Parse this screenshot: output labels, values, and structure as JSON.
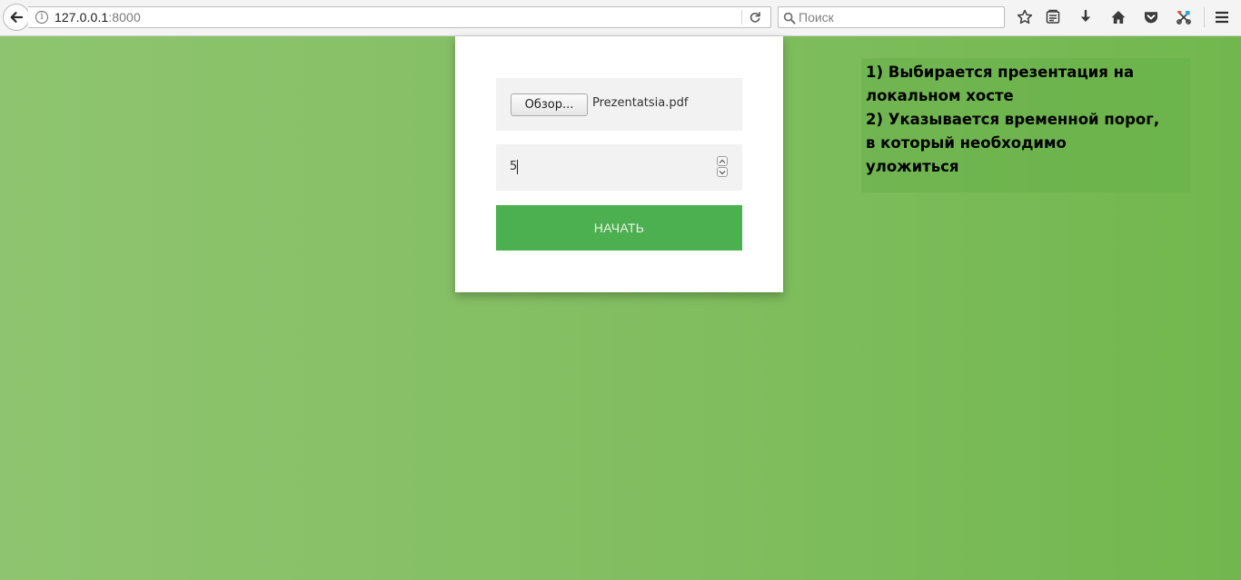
{
  "browser": {
    "url_host": "127.0.0.1",
    "url_port": ":8000",
    "search_placeholder": "Поиск",
    "icons": [
      "back-arrow-icon",
      "info-icon",
      "reload-icon",
      "search-icon",
      "bookmark-star-icon",
      "reading-list-icon",
      "download-icon",
      "home-icon",
      "pocket-icon",
      "extension-icon",
      "hamburger-menu-icon"
    ]
  },
  "form": {
    "browse_label": "Обзор...",
    "file_name": "Prezentatsia.pdf",
    "time_value": "5",
    "start_label": "НАЧАТЬ"
  },
  "notes": {
    "lines": [
      "1) Выбирается презентация на",
      "локальном хосте",
      "2) Указывается временной порог,",
      "в который необходимо",
      "уложиться"
    ]
  },
  "colors": {
    "background_green": "#84bf63",
    "start_button": "#4caf50",
    "card": "#ffffff",
    "field_background": "#f2f2f2"
  }
}
